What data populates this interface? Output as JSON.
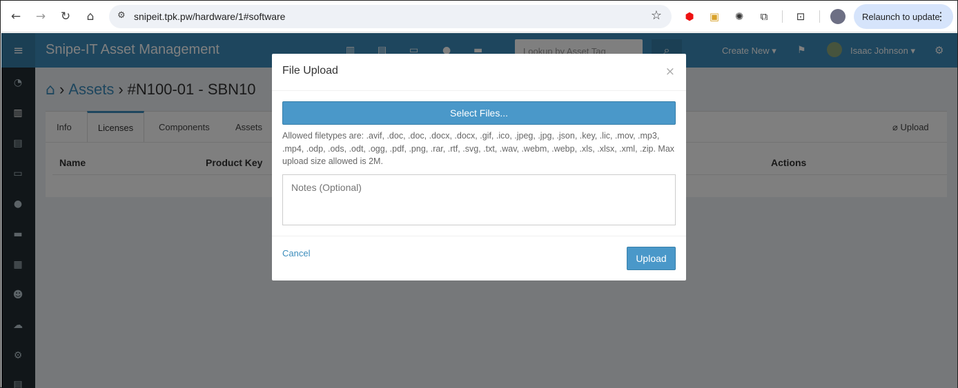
{
  "browser": {
    "url": "snipeit.tpk.pw/hardware/1#software",
    "relaunch_label": "Relaunch to update"
  },
  "app": {
    "brand": "Snipe-IT Asset Management",
    "search_placeholder": "Lookup by Asset Tag",
    "create_new_label": "Create New ▾",
    "user_name": "Isaac Johnson ▾",
    "accent_color": "#3c8dbc"
  },
  "breadcrumb": {
    "assets": "Assets",
    "asset": "#N100-01 - SBN10"
  },
  "tabs": {
    "info": "Info",
    "licenses": "Licenses",
    "components": "Components",
    "assets": "Assets",
    "upload": "Upload"
  },
  "table": {
    "headers": [
      "Name",
      "Product Key",
      "Actions"
    ]
  },
  "modal": {
    "title": "File Upload",
    "close": "×",
    "select_files": "Select Files...",
    "help_text": "Allowed filetypes are: .avif, .doc, .doc, .docx, .docx, .gif, .ico, .jpeg, .jpg, .json, .key, .lic, .mov, .mp3, .mp4, .odp, .ods, .odt, .ogg, .pdf, .png, .rar, .rtf, .svg, .txt, .wav, .webm, .webp, .xls, .xlsx, .xml, .zip. Max upload size allowed is 2M.",
    "notes_placeholder": "Notes (Optional)",
    "cancel": "Cancel",
    "upload": "Upload"
  }
}
